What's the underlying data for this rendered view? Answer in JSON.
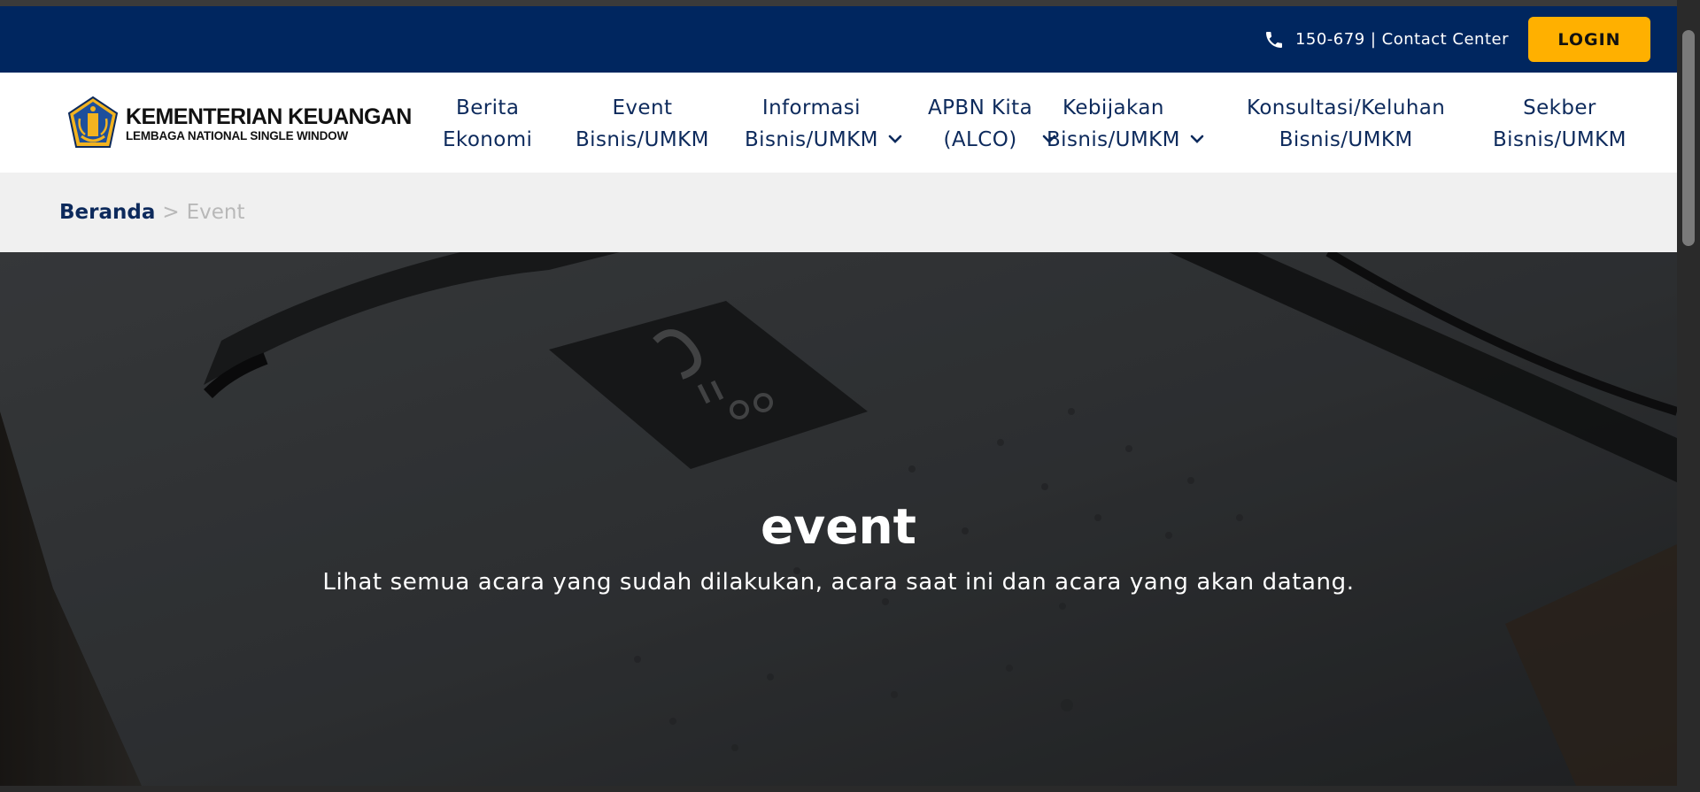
{
  "topbar": {
    "contact_text": "150-679 | Contact Center",
    "login_label": "LOGIN",
    "bg_color": "#00265f",
    "login_color": "#ffb000"
  },
  "logo": {
    "title": "KEMENTERIAN KEUANGAN",
    "subtitle": "LEMBAGA NATIONAL SINGLE WINDOW"
  },
  "nav": {
    "items": [
      {
        "line1": "Berita",
        "line2": "Ekonomi",
        "has_dropdown": false
      },
      {
        "line1": "Event",
        "line2": "Bisnis/UMKM",
        "has_dropdown": false
      },
      {
        "line1": "Informasi",
        "line2": "Bisnis/UMKM",
        "has_dropdown": true
      },
      {
        "line1": "APBN Kita",
        "line2": "(ALCO)",
        "has_dropdown": true
      },
      {
        "line1": "Kebijakan",
        "line2": "Bisnis/UMKM",
        "has_dropdown": true
      },
      {
        "line1": "Konsultasi/Keluhan",
        "line2": "Bisnis/UMKM",
        "has_dropdown": false
      },
      {
        "line1": "Sekber",
        "line2": "Bisnis/UMKM",
        "has_dropdown": false
      }
    ],
    "text_color": "#0d2a5c"
  },
  "breadcrumb": {
    "home": "Beranda",
    "separator": ">",
    "current": "Event"
  },
  "hero": {
    "title": "event",
    "subtitle": "Lihat semua acara yang sudah dilakukan, acara saat ini dan acara yang akan datang."
  },
  "icons": {
    "phone": "phone-icon",
    "chevron": "chevron-down-icon",
    "emblem": "kemenkeu-emblem-icon"
  }
}
